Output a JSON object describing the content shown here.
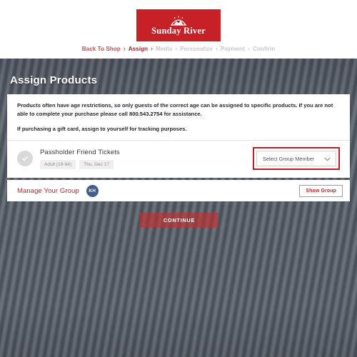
{
  "header": {
    "logo_text": "Sunday River",
    "logo_icon": "sun-mountain-icon"
  },
  "breadcrumb": {
    "separator": "›",
    "items": [
      {
        "label": "Back To Shop",
        "state": "back"
      },
      {
        "label": "Assign",
        "state": "current"
      },
      {
        "label": "Media",
        "state": "future"
      },
      {
        "label": "Personalize",
        "state": "future"
      },
      {
        "label": "Payment",
        "state": "future"
      },
      {
        "label": "Confirm",
        "state": "future"
      }
    ]
  },
  "page": {
    "title": "Assign Products"
  },
  "main": {
    "info_paragraph_1_prefix": "Products often have age restrictions, so only guests of the correct age can be assigned to specific products. If you are not able to complete your purchase please call ",
    "phone": "800.543.2754",
    "info_paragraph_1_suffix": " for assistance.",
    "info_paragraph_2": "If purchasing a gift card, assign to yourself for tracking purposes.",
    "product": {
      "status_icon": "check-circle-icon",
      "name": "Passholder Friend Tickets",
      "tags": [
        "Adult (19-64)",
        "Thu, Dec 17"
      ]
    },
    "member_select": {
      "value": "Select Group Member",
      "chevron_icon": "chevron-down-icon",
      "highlight_color": "#b81f26"
    }
  },
  "group": {
    "title": "Manage Your Group",
    "avatar_initials": "KH",
    "avatar_color": "#3f5f8f",
    "show_group_label": "Show Group"
  },
  "footer": {
    "continue_label": "CONTINUE"
  },
  "colors": {
    "brand_red": "#c62127",
    "link_red": "#c0272d",
    "background_gray": "#5b616b"
  }
}
